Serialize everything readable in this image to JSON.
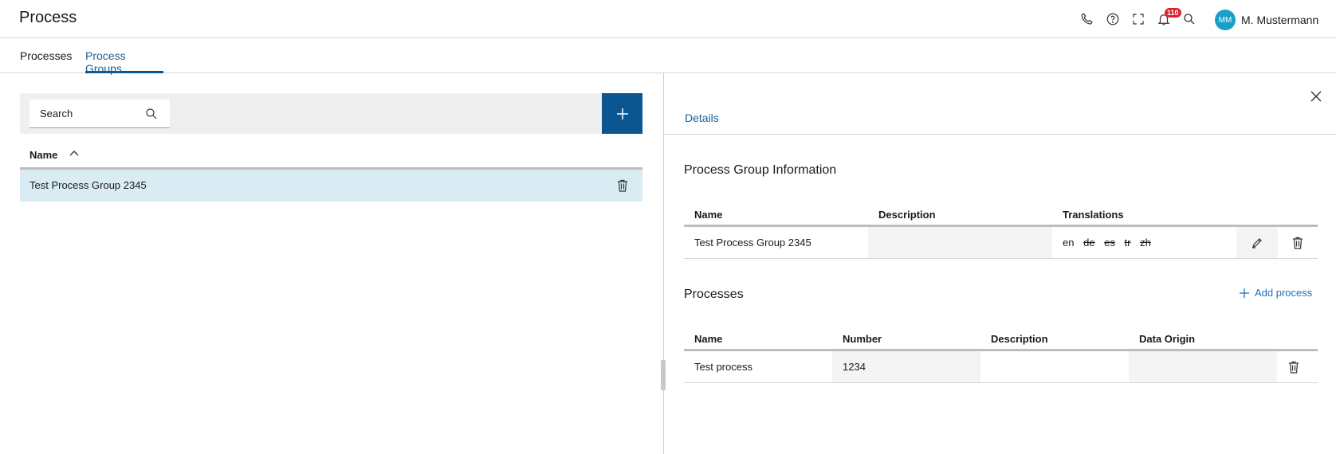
{
  "header": {
    "title": "Process",
    "icons": [
      "phone-icon",
      "help-icon",
      "fullscreen-icon",
      "bell-icon",
      "search-icon"
    ],
    "notification_count": "110",
    "user": {
      "initials": "MM",
      "name": "M. Mustermann"
    }
  },
  "tabs": [
    {
      "label": "Processes",
      "active": false
    },
    {
      "label": "Process Groups",
      "active": true
    }
  ],
  "list": {
    "search_placeholder": "Search",
    "column_name": "Name",
    "sort": "ascending",
    "rows": [
      {
        "name": "Test Process Group 2345",
        "selected": true
      }
    ]
  },
  "details": {
    "tab_label": "Details",
    "group_info": {
      "title": "Process Group Information",
      "columns": [
        "Name",
        "Description",
        "Translations"
      ],
      "row": {
        "name": "Test Process Group 2345",
        "description": "",
        "translations": [
          {
            "code": "en",
            "available": true
          },
          {
            "code": "de",
            "available": false
          },
          {
            "code": "es",
            "available": false
          },
          {
            "code": "tr",
            "available": false
          },
          {
            "code": "zh",
            "available": false
          }
        ]
      }
    },
    "processes": {
      "title": "Processes",
      "add_label": "Add process",
      "columns": [
        "Name",
        "Number",
        "Description",
        "Data Origin"
      ],
      "rows": [
        {
          "name": "Test process",
          "number": "1234",
          "description": "",
          "data_origin": ""
        }
      ]
    }
  },
  "colors": {
    "primary": "#0b5591",
    "link": "#1f70b8",
    "selected_row": "#d9ebf3",
    "badge": "#e0202e",
    "avatar": "#19a0c8"
  }
}
